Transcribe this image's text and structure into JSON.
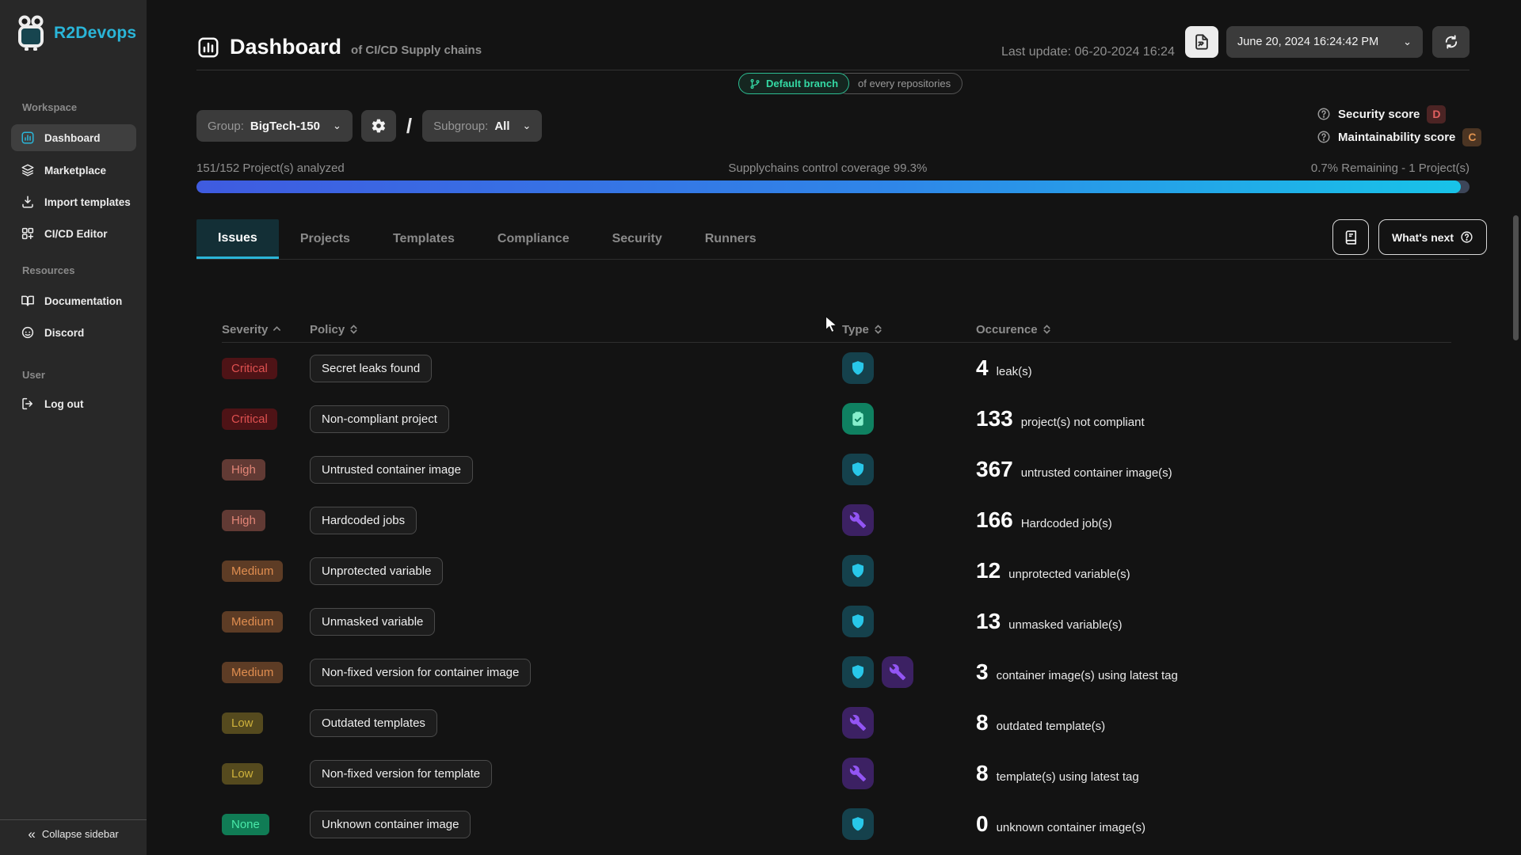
{
  "app": {
    "name": "R2Devops",
    "accent_color": "#2ab5d8"
  },
  "sidebar": {
    "sections": [
      {
        "label": "Workspace",
        "items": [
          {
            "label": "Dashboard",
            "icon": "bar-chart-icon",
            "active": true
          },
          {
            "label": "Marketplace",
            "icon": "layers-icon",
            "active": false
          },
          {
            "label": "Import templates",
            "icon": "download-icon",
            "active": false
          },
          {
            "label": "CI/CD Editor",
            "icon": "grid-plus-icon",
            "active": false
          }
        ]
      },
      {
        "label": "Resources",
        "items": [
          {
            "label": "Documentation",
            "icon": "book-icon",
            "active": false
          },
          {
            "label": "Discord",
            "icon": "discord-icon",
            "active": false
          }
        ]
      },
      {
        "label": "User",
        "items": [
          {
            "label": "Log out",
            "icon": "logout-icon",
            "active": false
          }
        ]
      }
    ],
    "collapse_label": "Collapse sidebar",
    "collapse_icon": "chevrons-left-icon"
  },
  "header": {
    "title": "Dashboard",
    "subtitle": "of CI/CD Supply chains",
    "title_icon": "bar-chart-icon",
    "last_update": "Last update: 06-20-2024 16:24",
    "report_button_icon": "report-document-icon",
    "datetime_value": "June 20, 2024 16:24:42 PM",
    "refresh_icon": "refresh-icon",
    "branch_badge": "Default branch",
    "branch_badge_icon": "git-branch-icon",
    "branch_badge_color": "#34d9a4",
    "branch_scope": "of every repositories"
  },
  "filters": {
    "group_label": "Group:",
    "group_value": "BigTech-150",
    "gear_icon": "gear-icon",
    "separator": "/",
    "subgroup_label": "Subgroup:",
    "subgroup_value": "All"
  },
  "scores": {
    "security_label": "Security score",
    "security_grade": "D",
    "maintainability_label": "Maintainability score",
    "maintainability_grade": "C",
    "help_icon": "question-circle-icon"
  },
  "progress": {
    "left_label": "151/152 Project(s) analyzed",
    "center_label": "Supplychains control coverage 99.3%",
    "right_label": "0.7% Remaining - 1 Project(s)",
    "percent": 99.3
  },
  "tabs": [
    {
      "label": "Issues",
      "active": true
    },
    {
      "label": "Projects",
      "active": false
    },
    {
      "label": "Templates",
      "active": false
    },
    {
      "label": "Compliance",
      "active": false
    },
    {
      "label": "Security",
      "active": false
    },
    {
      "label": "Runners",
      "active": false
    }
  ],
  "actions": {
    "docs_button_icon": "book-icon",
    "whats_next_label": "What's next",
    "whats_next_icon": "question-circle-icon"
  },
  "table": {
    "headers": [
      "Severity",
      "Policy",
      "Type",
      "Occurence"
    ],
    "sort": {
      "severity": "asc",
      "others": "both"
    },
    "severity_styles": {
      "Critical": {
        "bg": "#4e1316",
        "fg": "#df5050"
      },
      "High": {
        "bg": "#613a34",
        "fg": "#e28577"
      },
      "Medium": {
        "bg": "#5d3c25",
        "fg": "#e08e50"
      },
      "Low": {
        "bg": "#554a1e",
        "fg": "#cfb23c"
      },
      "None": {
        "bg": "#107c55",
        "fg": "#49e9a9"
      }
    },
    "type_styles": {
      "shield-icon": {
        "bg": "#15414c",
        "fg": "#28c7e9"
      },
      "clipboard-check-icon": {
        "bg": "#0f8161",
        "fg": "#86efcc"
      },
      "wrench-icon": {
        "bg": "#3c2163",
        "fg": "#9355f4"
      }
    },
    "rows": [
      {
        "severity": "Critical",
        "policy": "Secret leaks found",
        "types": [
          "shield-icon"
        ],
        "count": "4",
        "label": "leak(s)"
      },
      {
        "severity": "Critical",
        "policy": "Non-compliant project",
        "types": [
          "clipboard-check-icon"
        ],
        "count": "133",
        "label": "project(s) not compliant"
      },
      {
        "severity": "High",
        "policy": "Untrusted container image",
        "types": [
          "shield-icon"
        ],
        "count": "367",
        "label": "untrusted container image(s)"
      },
      {
        "severity": "High",
        "policy": "Hardcoded jobs",
        "types": [
          "wrench-icon"
        ],
        "count": "166",
        "label": "Hardcoded job(s)"
      },
      {
        "severity": "Medium",
        "policy": "Unprotected variable",
        "types": [
          "shield-icon"
        ],
        "count": "12",
        "label": "unprotected variable(s)"
      },
      {
        "severity": "Medium",
        "policy": "Unmasked variable",
        "types": [
          "shield-icon"
        ],
        "count": "13",
        "label": "unmasked variable(s)"
      },
      {
        "severity": "Medium",
        "policy": "Non-fixed version for container image",
        "types": [
          "shield-icon",
          "wrench-icon"
        ],
        "count": "3",
        "label": "container image(s) using latest tag"
      },
      {
        "severity": "Low",
        "policy": "Outdated templates",
        "types": [
          "wrench-icon"
        ],
        "count": "8",
        "label": "outdated template(s)"
      },
      {
        "severity": "Low",
        "policy": "Non-fixed version for template",
        "types": [
          "wrench-icon"
        ],
        "count": "8",
        "label": "template(s) using latest tag"
      },
      {
        "severity": "None",
        "policy": "Unknown container image",
        "types": [
          "shield-icon"
        ],
        "count": "0",
        "label": "unknown container image(s)"
      }
    ]
  }
}
